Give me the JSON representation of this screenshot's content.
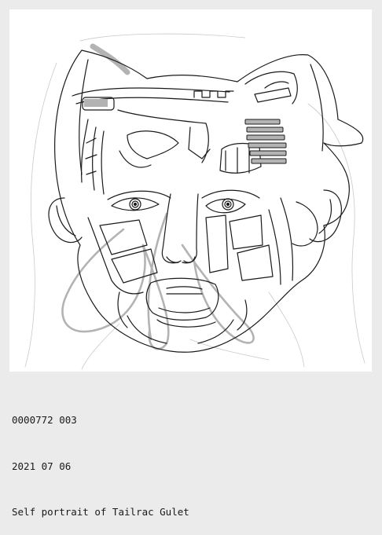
{
  "artwork": {
    "subject": "line drawing of a stylized mechanical face",
    "stroke_color": "#1a1a1a",
    "faint_stroke_color": "#bdbdbd",
    "accent_gray": "#b3b3b3"
  },
  "caption": {
    "catalog_id": "0000772 003",
    "date": "2021 07 06",
    "title": "Self portrait of Tailrac Gulet"
  }
}
